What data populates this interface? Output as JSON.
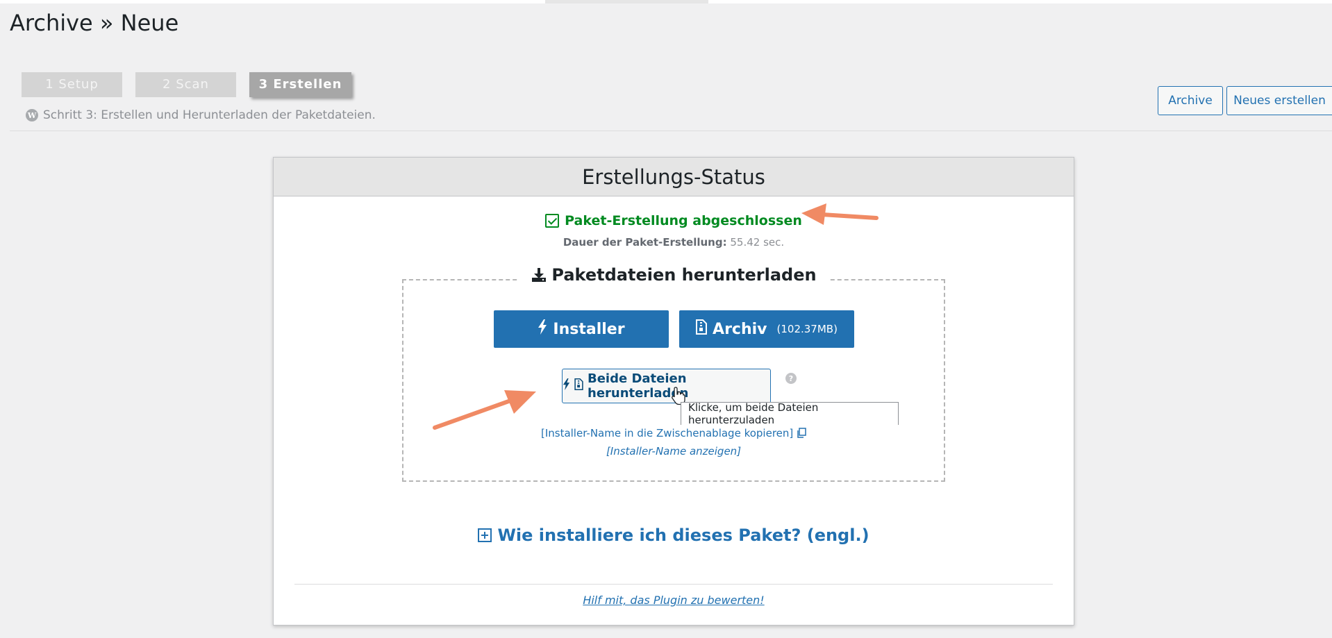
{
  "page": {
    "title": "Archive » Neue"
  },
  "steps": [
    {
      "label": "1 Setup",
      "state": "done"
    },
    {
      "label": "2 Scan",
      "state": "done"
    },
    {
      "label": "3 Erstellen",
      "state": "active"
    }
  ],
  "step_description": "Schritt 3: Erstellen und Herunterladen der Paketdateien.",
  "header_buttons": {
    "archive": "Archive",
    "new": "Neues erstellen"
  },
  "panel": {
    "title": "Erstellungs-Status",
    "status": "Paket-Erstellung abgeschlossen",
    "duration_label": "Dauer der Paket-Erstellung:",
    "duration_value": "55.42 sec.",
    "download": {
      "title": "Paketdateien herunterladen",
      "installer_label": "Installer",
      "archive_label": "Archiv",
      "archive_size": "(102.37MB)",
      "both_label": "Beide Dateien herunterladen",
      "help_mark": "?",
      "tooltip": "Klicke, um beide Dateien herunterzuladen",
      "copy_link": "[Installer-Name in die Zwischenablage kopieren]",
      "show_link": "[Installer-Name anzeigen]"
    },
    "howto": "Wie installiere ich dieses Paket? (engl.)",
    "rate_link": "Hilf mit, das Plugin zu bewerten!"
  },
  "colors": {
    "primary": "#2271b1",
    "success": "#008a20",
    "annotation_arrow": "#f08a64"
  },
  "icons": [
    "wordpress-logo-icon",
    "checkbox-check-icon",
    "download-icon",
    "bolt-icon",
    "file-archive-icon",
    "help-icon",
    "copy-icon",
    "plus-square-icon",
    "hand-cursor-icon",
    "annotation-arrow"
  ]
}
